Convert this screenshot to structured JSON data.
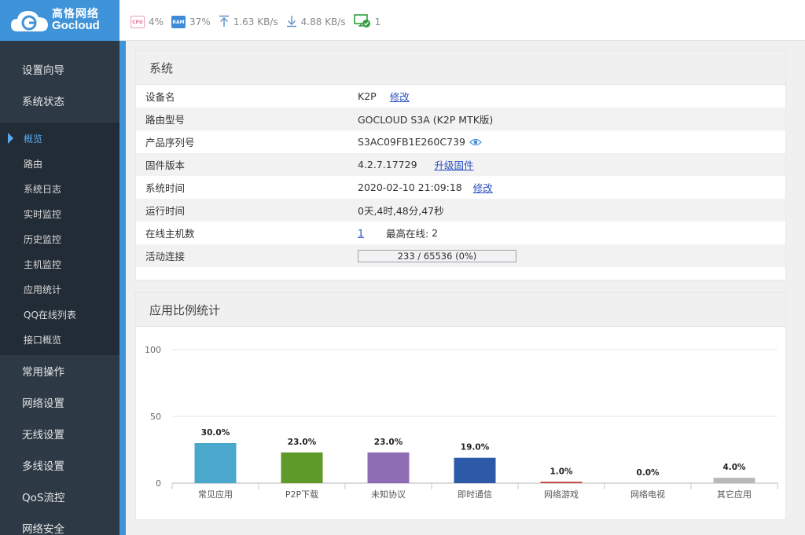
{
  "brand": {
    "name_cn": "高恪网络",
    "name_en": "Gocloud",
    "primary": "#3f93d9"
  },
  "status": {
    "cpu_chip": "CPU",
    "cpu": "4%",
    "ram_chip": "RAM",
    "ram": "37%",
    "upload": "1.63 KB/s",
    "download": "4.88 KB/s",
    "hosts": "1"
  },
  "sidebar": {
    "top": [
      "设置向导",
      "系统状态"
    ],
    "sub": [
      "概览",
      "路由",
      "系统日志",
      "实时监控",
      "历史监控",
      "主机监控",
      "应用统计",
      "QQ在线列表",
      "接口概览"
    ],
    "bottom": [
      "常用操作",
      "网络设置",
      "无线设置",
      "多线设置",
      "QoS流控",
      "网络安全"
    ]
  },
  "system": {
    "title": "系统",
    "rows": {
      "device_name": {
        "label": "设备名",
        "value": "K2P",
        "link": "修改"
      },
      "model": {
        "label": "路由型号",
        "value": "GOCLOUD S3A (K2P MTK版)"
      },
      "serial": {
        "label": "产品序列号",
        "value": "S3AC09FB1E260C739"
      },
      "firmware": {
        "label": "固件版本",
        "value": "4.2.7.17729",
        "link": "升级固件"
      },
      "time": {
        "label": "系统时间",
        "value": "2020-02-10 21:09:18",
        "link": "修改"
      },
      "uptime": {
        "label": "运行时间",
        "value": "0天,4时,48分,47秒"
      },
      "hosts": {
        "label": "在线主机数",
        "value": "1",
        "max_label": "最高在线:",
        "max_value": "2"
      },
      "conns": {
        "label": "活动连接",
        "value": "233 / 65536 (0%)",
        "fill": 0.0
      }
    }
  },
  "app_stats": {
    "title": "应用比例统计"
  },
  "chart_data": {
    "type": "bar",
    "categories": [
      "常见应用",
      "P2P下载",
      "未知协议",
      "即时通信",
      "网络游戏",
      "网络电视",
      "其它应用"
    ],
    "values": [
      30.0,
      23.0,
      23.0,
      19.0,
      1.0,
      0.0,
      4.0
    ],
    "value_labels": [
      "30.0%",
      "23.0%",
      "23.0%",
      "19.0%",
      "1.0%",
      "0.0%",
      "4.0%"
    ],
    "colors": [
      "#4aa8cc",
      "#5e9a2a",
      "#8e6cb3",
      "#2c5aa8",
      "#c0392b",
      "#999999",
      "#b8b8b8"
    ],
    "yticks": [
      0,
      50,
      100
    ],
    "ylim": [
      0,
      100
    ],
    "grid": true
  }
}
